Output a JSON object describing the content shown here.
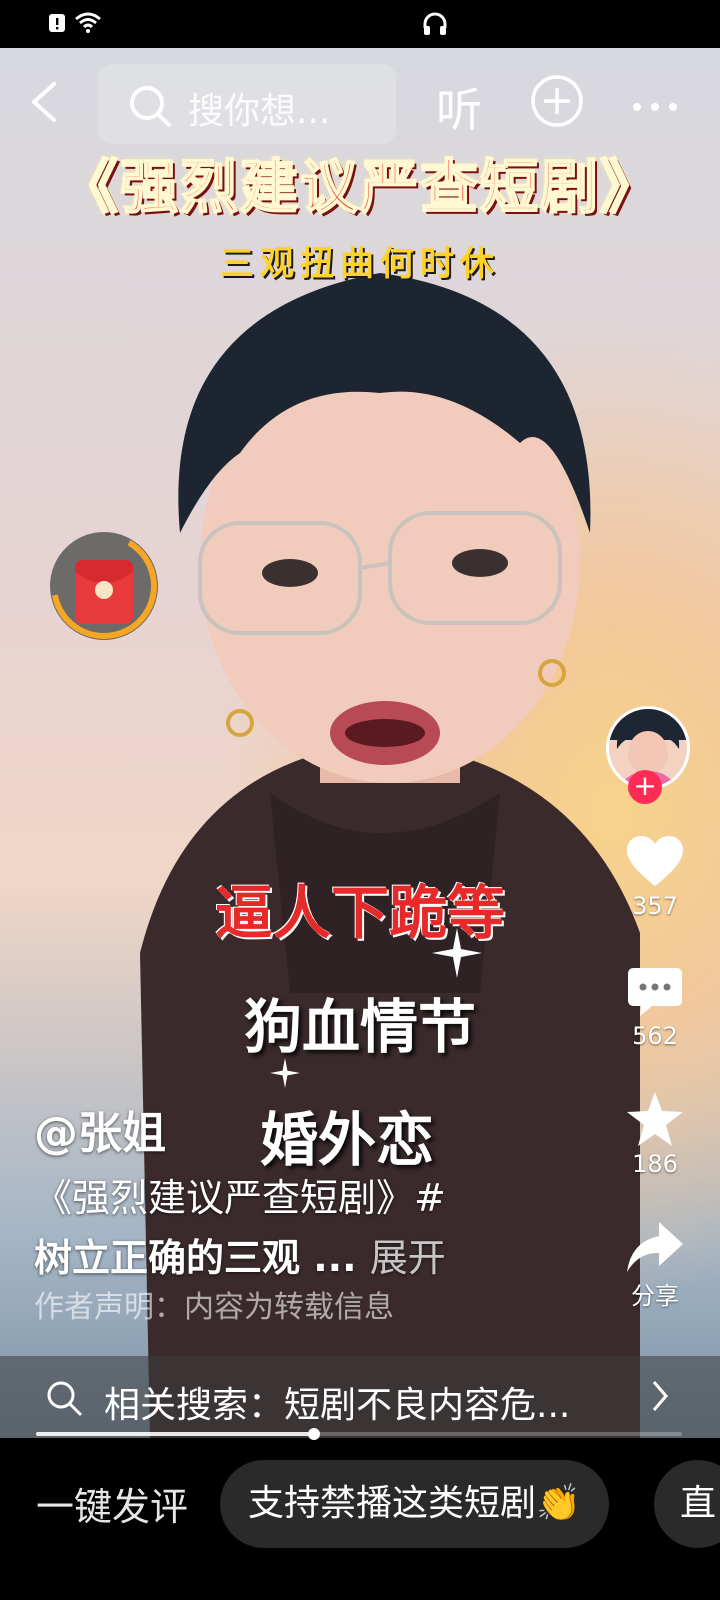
{
  "status_bar": {
    "icons": [
      "battery-alert-icon",
      "wifi-icon",
      "headphones-icon"
    ]
  },
  "top_nav": {
    "search_placeholder": "搜你想...",
    "listen_label": "听",
    "icons": [
      "back-icon",
      "search-icon",
      "add-icon",
      "more-icon"
    ]
  },
  "video": {
    "title": "《强烈建议严查短剧》",
    "subtitle": "三观扭曲何时休",
    "captions": [
      "逼人下跪等",
      "狗血情节",
      "婚外恋"
    ]
  },
  "side_actions": {
    "likes": "357",
    "comments": "562",
    "favorites": "186",
    "share_label": "分享"
  },
  "post": {
    "author": "@张姐",
    "description_line1": "《强烈建议严查短剧》#",
    "description_line2": "树立正确的三观 ...",
    "expand_label": "展开",
    "declaration": "作者声明：内容为转载信息"
  },
  "related_search": {
    "text": "相关搜索：短剧不良内容危..."
  },
  "playback": {
    "progress": 0.43
  },
  "bottom_bar": {
    "quick_comment_label": "一键发评",
    "suggestion_chip": "支持禁播这类短剧👏",
    "next_chip": "直"
  },
  "colors": {
    "accent_red": "#fe2c55",
    "packet_red": "#e8393c",
    "ring_orange": "#f5a623"
  }
}
